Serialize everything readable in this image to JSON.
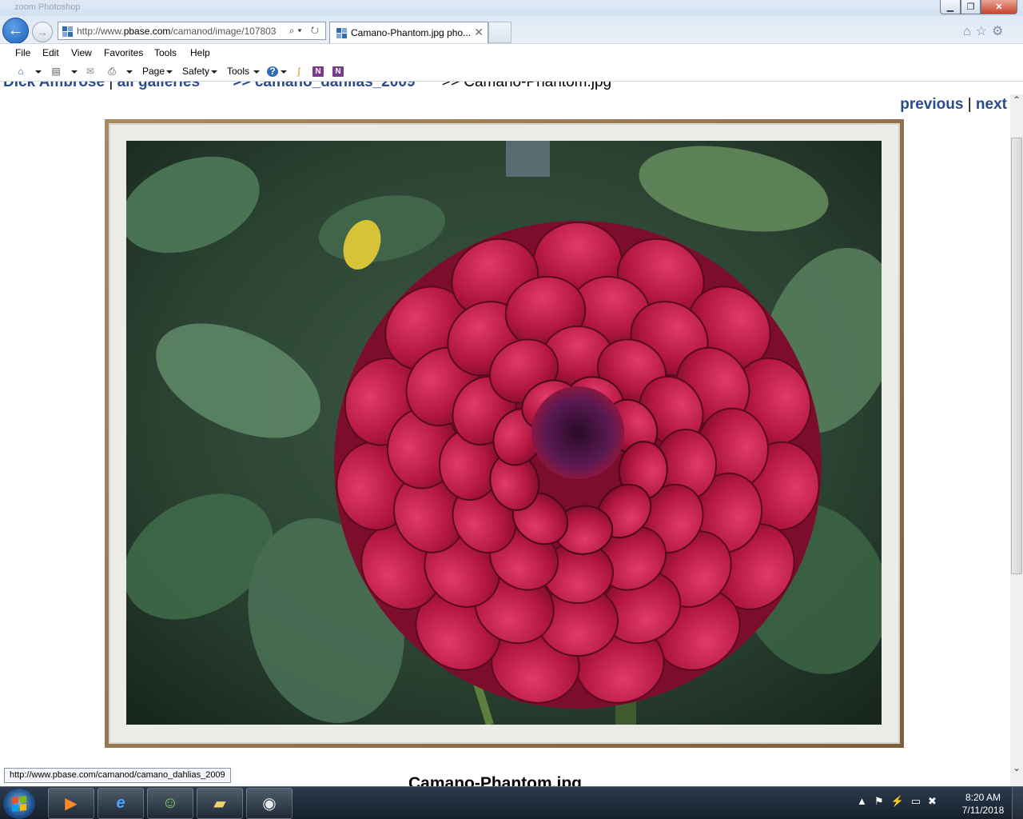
{
  "window": {
    "title": "zoom Photoshop",
    "min_label": "▁",
    "max_label": "❐",
    "close_label": "✕"
  },
  "nav": {
    "back_label": "←",
    "forward_label": "→",
    "address_prefix": "http://www.",
    "address_domain": "pbase.com",
    "address_rest": "/camanod/image/107803",
    "address_icons": "⌕▾ ↻",
    "tab_title": "Camano-Phantom.jpg pho...",
    "tab_close": "✕",
    "right_icons": "⌂☆⚙"
  },
  "menu": [
    "File",
    "Edit",
    "View",
    "Favorites",
    "Tools",
    "Help"
  ],
  "commandbar": {
    "page": "Page",
    "safety": "Safety",
    "tools": "Tools"
  },
  "page": {
    "breadcrumb_user": "Dick Ambrose",
    "breadcrumb_sep": "|",
    "breadcrumb_all": "all galleries",
    "breadcrumb_gallery": ">> camano_dahlias_2009",
    "breadcrumb_current": ">> Camano-Phantom.jpg",
    "previous": "previous",
    "pn_sep": "|",
    "next": "next",
    "caption": "Camano-Phantom.jpg"
  },
  "scrollbar": {
    "up": "⌃",
    "down": "⌄"
  },
  "status_tip": "http://www.pbase.com/camanod/camano_dahlias_2009",
  "taskbar": {
    "tray_icons": "▲⚑⚡▭✖",
    "time": "8:20 AM",
    "date": "7/11/2018"
  },
  "colors": {
    "link": "#2a4b8d",
    "frame": "#8b6b45",
    "taskbar": "#1c2836"
  }
}
